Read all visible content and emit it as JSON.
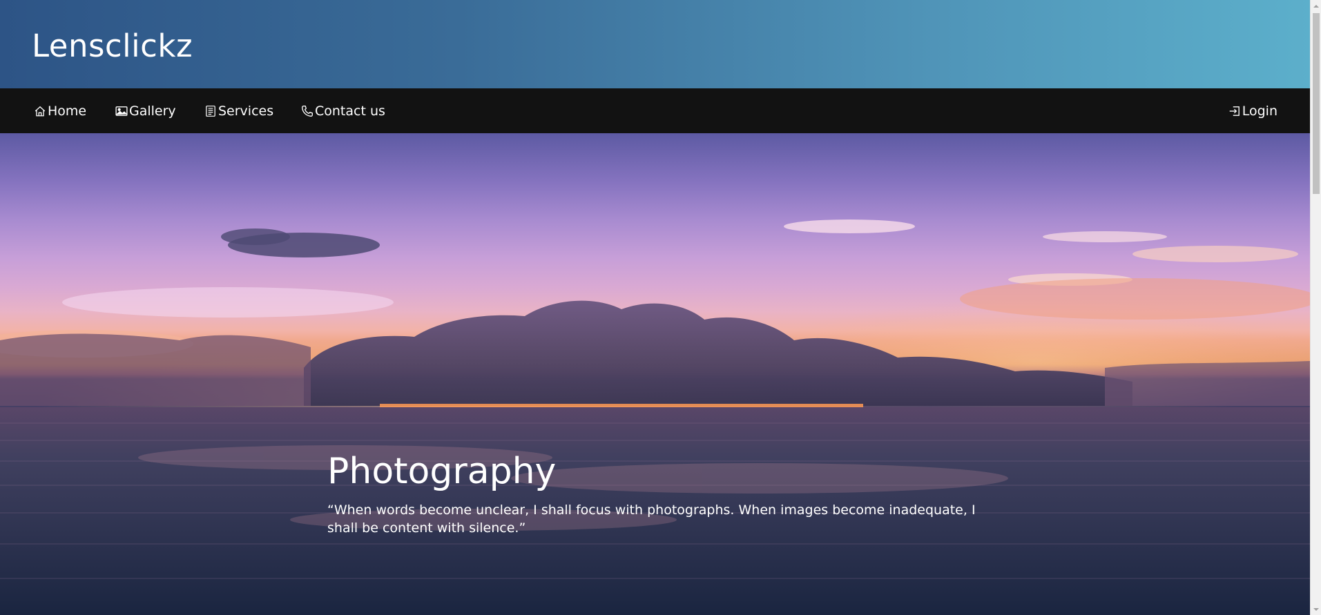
{
  "brand": {
    "name": "Lensclickz"
  },
  "nav": {
    "home": "Home",
    "gallery": "Gallery",
    "services": "Services",
    "contact": "Contact us",
    "login": "Login"
  },
  "hero": {
    "title": "Photography",
    "quote": "“When words become unclear, I shall focus with photographs. When images become inadequate, I shall be content with silence.”"
  },
  "icons": {
    "home": "home-icon",
    "gallery": "image-icon",
    "services": "list-icon",
    "contact": "phone-icon",
    "login": "sign-in-icon"
  },
  "colors": {
    "header_gradient_start": "#2d5486",
    "header_gradient_end": "#5cafcb",
    "nav_background": "#121212",
    "text": "#ffffff"
  }
}
